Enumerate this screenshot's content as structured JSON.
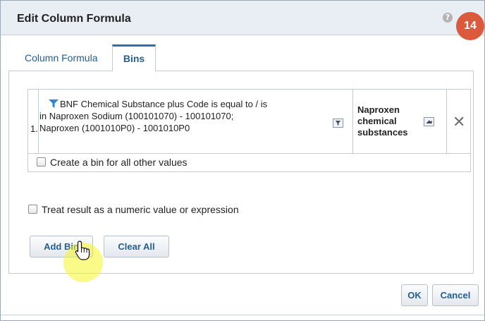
{
  "dialog": {
    "title": "Edit Column Formula",
    "help_icon": "question-icon",
    "step_badge": "14"
  },
  "tabs": [
    {
      "label": "Column Formula",
      "active": false
    },
    {
      "label": "Bins",
      "active": true
    }
  ],
  "bins": [
    {
      "index": "1.",
      "condition_line1": "BNF Chemical Substance plus Code is equal to / is",
      "condition_line2": "in  Naproxen Sodium (100101070) - 100101070;",
      "condition_line3": "Naproxen (1001010P0) - 1001010P0",
      "bin_name_line1": "Naproxen",
      "bin_name_line2": "chemical",
      "bin_name_line3": "substances"
    }
  ],
  "options": {
    "other_values_label": "Create a bin for all other values",
    "other_values_checked": false,
    "numeric_label": "Treat result as a numeric value or expression",
    "numeric_checked": false
  },
  "buttons": {
    "add_bin": "Add Bin",
    "clear_all": "Clear All",
    "ok": "OK",
    "cancel": "Cancel"
  },
  "colors": {
    "accent": "#245e92",
    "badge": "#db5a3c",
    "highlight": "#f5f528"
  }
}
